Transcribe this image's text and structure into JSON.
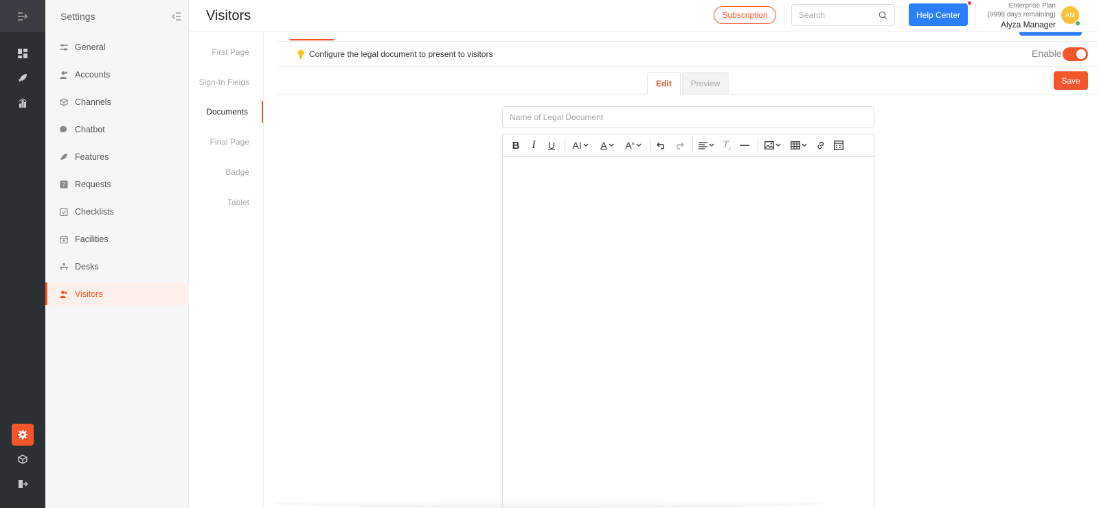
{
  "header": {
    "title": "Visitors",
    "subscription_label": "Subscription",
    "search_placeholder": "Search",
    "help_label": "Help Center",
    "plan_name": "Enterprise Plan",
    "plan_remaining": "(9999 days remaining)",
    "user_name": "Alyza Manager",
    "avatar_initials": "AM"
  },
  "sidebar": {
    "title": "Settings",
    "items": [
      {
        "label": "General",
        "icon": "sliders-icon"
      },
      {
        "label": "Accounts",
        "icon": "users-icon"
      },
      {
        "label": "Channels",
        "icon": "cube-icon"
      },
      {
        "label": "Chatbot",
        "icon": "chat-bubble-icon"
      },
      {
        "label": "Features",
        "icon": "rocket-icon"
      },
      {
        "label": "Requests",
        "icon": "question-square-icon"
      },
      {
        "label": "Checklists",
        "icon": "clipboard-check-icon"
      },
      {
        "label": "Facilities",
        "icon": "calendar-plus-icon"
      },
      {
        "label": "Desks",
        "icon": "desk-icon"
      },
      {
        "label": "Visitors",
        "icon": "visitor-icon",
        "active": true
      }
    ]
  },
  "subnav": {
    "items": [
      {
        "label": "First Page"
      },
      {
        "label": "Sign-In Fields"
      },
      {
        "label": "Documents",
        "active": true
      },
      {
        "label": "Final Page"
      },
      {
        "label": "Badge"
      },
      {
        "label": "Tablet"
      }
    ]
  },
  "main": {
    "info_text": "Configure the legal document to present to visitors",
    "enable_label": "Enable",
    "enabled": true,
    "tabs": [
      {
        "label": "Edit",
        "active": true
      },
      {
        "label": "Preview"
      }
    ],
    "save_label": "Save",
    "doc_name_placeholder": "Name of Legal Document"
  },
  "colors": {
    "accent": "#f2572b",
    "primary_blue": "#2d7ff9",
    "rail": "#2c3035"
  }
}
